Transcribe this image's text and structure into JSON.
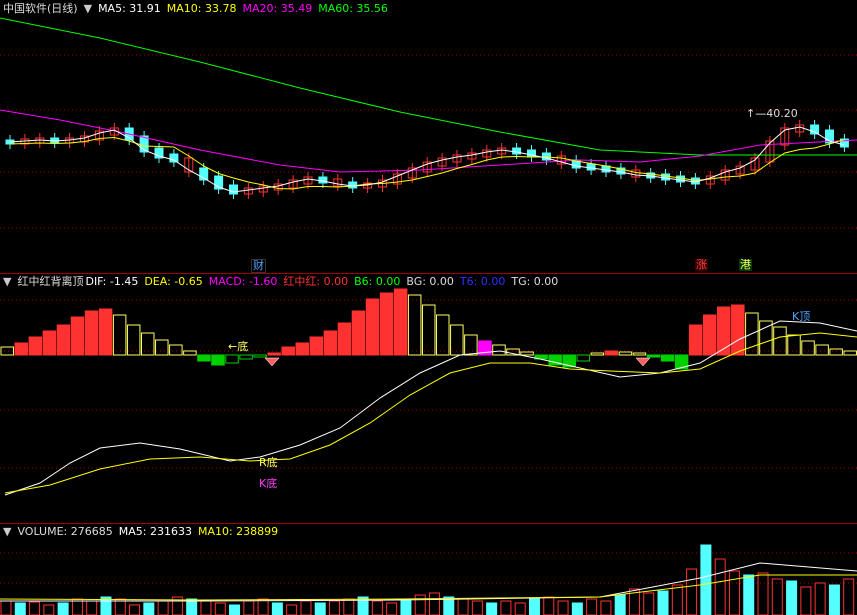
{
  "price_panel": {
    "title": "中国软件(日线)",
    "ma5": "MA5: 31.91",
    "ma10": "MA10: 33.78",
    "ma20": "MA20: 35.49",
    "ma60": "MA60: 35.56",
    "high_marker": "40.20",
    "event_tags": [
      "财",
      "涨",
      "港"
    ]
  },
  "macd_panel": {
    "title": "红中红背离顶",
    "dif": "DIF: -1.45",
    "dea": "DEA: -0.65",
    "macd": "MACD: -1.60",
    "hzh": "红中红: 0.00",
    "b6": "B6: 0.00",
    "bg": "BG: 0.00",
    "t6": "T6: 0.00",
    "tg": "TG: 0.00",
    "labels": {
      "bottom_arrow": "←底",
      "r_bottom": "R底",
      "k_bottom": "K底",
      "k_top": "K顶"
    }
  },
  "volume_panel": {
    "volume": "VOLUME: 276685",
    "ma5": "MA5: 231633",
    "ma10": "MA10: 238899"
  },
  "colors": {
    "up": "#ff3232",
    "down": "#54ffff",
    "ma5": "#ffffff",
    "ma10": "#ffff00",
    "ma20": "#ff00ff",
    "ma60": "#00ff00",
    "grid": "#a00000"
  }
}
